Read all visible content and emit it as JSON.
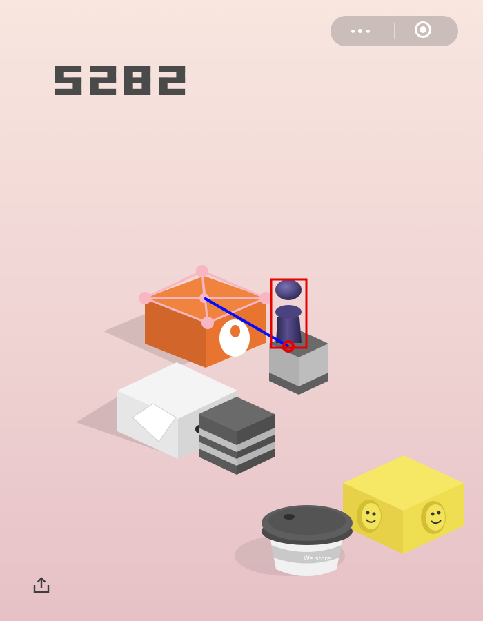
{
  "game": {
    "score": "5282",
    "colors": {
      "score": "#4a4a4a",
      "orange_block": "#ee7a37",
      "yellow_block": "#f3e35a",
      "gray_block": "#6b6b6b",
      "player": "#3a3160",
      "overlay_box": "#e60000",
      "overlay_line": "#0010ff",
      "overlay_mesh": "#f7b6c2"
    }
  },
  "blocks": {
    "cup_logo": "We store"
  },
  "miniprogram_capsule": {
    "more_icon": "more-dots-icon",
    "close_icon": "target-circle-icon"
  },
  "toolbar": {
    "share_icon": "share-upload-icon"
  }
}
